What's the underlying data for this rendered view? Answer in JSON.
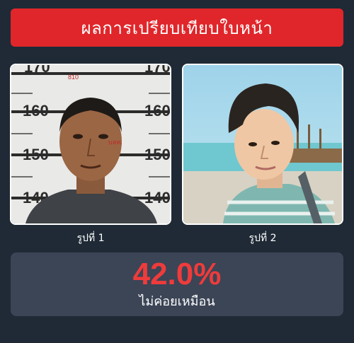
{
  "header": {
    "title": "ผลการเปรียบเทียบใบหน้า"
  },
  "photos": [
    {
      "caption": "รูปที่ 1",
      "height_marks": [
        "170",
        "170",
        "160",
        "160",
        "150",
        "150",
        "140",
        "140"
      ],
      "overlay_number": "810",
      "overlay_tag": "บลท."
    },
    {
      "caption": "รูปที่ 2"
    }
  ],
  "result": {
    "score": "42.0%",
    "verdict": "ไม่ค่อยเหมือน"
  },
  "colors": {
    "background": "#1f2a36",
    "header": "#e0262a",
    "result_panel": "#3b4556",
    "score": "#ef3b3b"
  }
}
